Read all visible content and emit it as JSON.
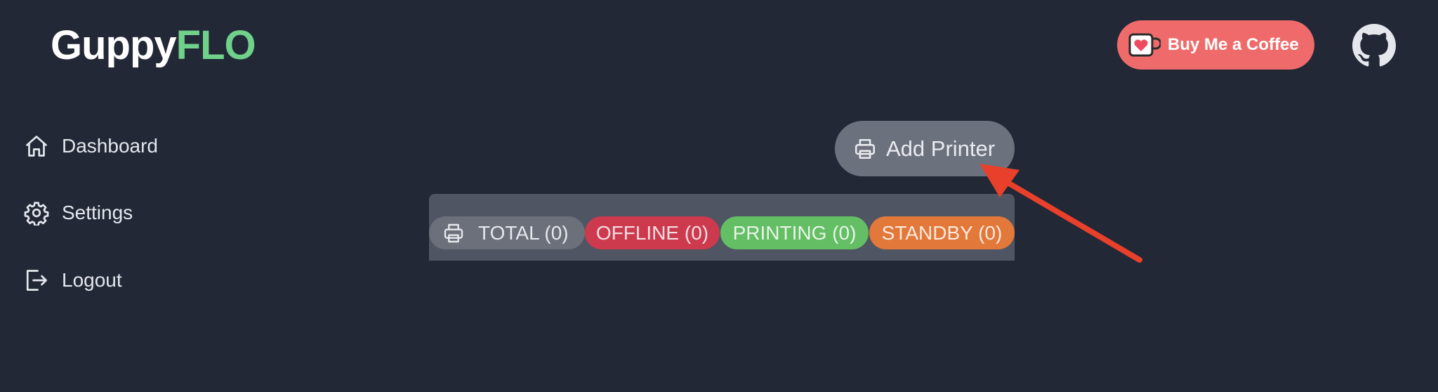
{
  "header": {
    "logo_part1": "Guppy",
    "logo_part2": "FLO",
    "coffee_label": "Buy Me a Coffee",
    "github_icon": "github-icon"
  },
  "sidebar": {
    "items": [
      {
        "label": "Dashboard",
        "icon": "home-icon"
      },
      {
        "label": "Settings",
        "icon": "gear-icon"
      },
      {
        "label": "Logout",
        "icon": "logout-icon"
      }
    ]
  },
  "main": {
    "add_printer_label": "Add Printer",
    "status": [
      {
        "label": "TOTAL (0)",
        "color": "#6b707b"
      },
      {
        "label": "OFFLINE (0)",
        "color": "#cd3a4e"
      },
      {
        "label": "PRINTING (0)",
        "color": "#63be64"
      },
      {
        "label": "STANDBY (0)",
        "color": "#e2783a"
      }
    ]
  },
  "colors": {
    "background": "#222836",
    "accent_green": "#6fd18a",
    "coffee": "#ef6b6b",
    "annotation_arrow": "#e8402a"
  }
}
